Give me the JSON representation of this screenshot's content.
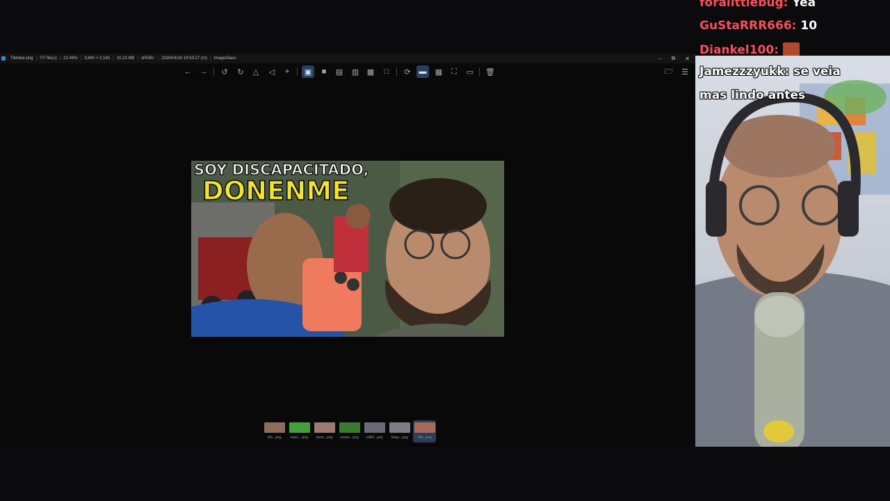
{
  "window": {
    "filename": "Tiktoker.png",
    "file_count": "7/7 file(s)",
    "zoom": "22.49%",
    "dimensions": "3,840 × 2,160",
    "size": "10.23 MB",
    "color_space": "sRGB/-",
    "datetime": "2026/04/16 19:53:27 (m)",
    "app_name": "ImageGlass",
    "controls": {
      "minimize": "–",
      "restore": "⧉",
      "close": "✕"
    }
  },
  "toolbar": {
    "icons": [
      "arrow-left-icon",
      "arrow-right-icon",
      "rotate-left-icon",
      "rotate-right-icon",
      "flip-horizontal-icon",
      "flip-vertical-icon",
      "crop-icon",
      "zoom-fit-icon",
      "lock-zoom-icon",
      "fit-width-icon",
      "fit-height-icon",
      "fill-icon",
      "actual-size-icon",
      "refresh-icon",
      "thumbnail-bar-icon",
      "checkerboard-icon",
      "fullscreen-icon",
      "slideshow-icon",
      "delete-icon",
      "open-folder-icon",
      "menu-icon"
    ]
  },
  "image": {
    "headline_1": "SOY DISCAPACITADO,",
    "headline_2": "DONENME"
  },
  "thumbnails": [
    {
      "label": "dlS...png",
      "color": "#8e6e5a"
    },
    {
      "label": "marc....png",
      "color": "#3fa03c"
    },
    {
      "label": "mem...png",
      "color": "#9b7a70"
    },
    {
      "label": "meme...png",
      "color": "#3c7a2e"
    },
    {
      "label": "mBN...psd",
      "color": "#6d6a78"
    },
    {
      "label": "Sequ...png",
      "color": "#7e7e86"
    },
    {
      "label": "Tikt...png",
      "color": "#a86a58",
      "active": true
    }
  ],
  "chat": {
    "messages": [
      {
        "user": "forallttlebug:",
        "text": "Yea"
      },
      {
        "user": "GuStaRRR666:",
        "text": "10"
      },
      {
        "user": "Diankel100:",
        "text": ""
      },
      {
        "user": "Jamezzzyukk:",
        "text": "se veia"
      },
      {
        "user": "",
        "text": "mas lindo antes"
      }
    ]
  },
  "colors": {
    "accent": "#2d8ed6",
    "chat_user": "#ff4d5a"
  }
}
